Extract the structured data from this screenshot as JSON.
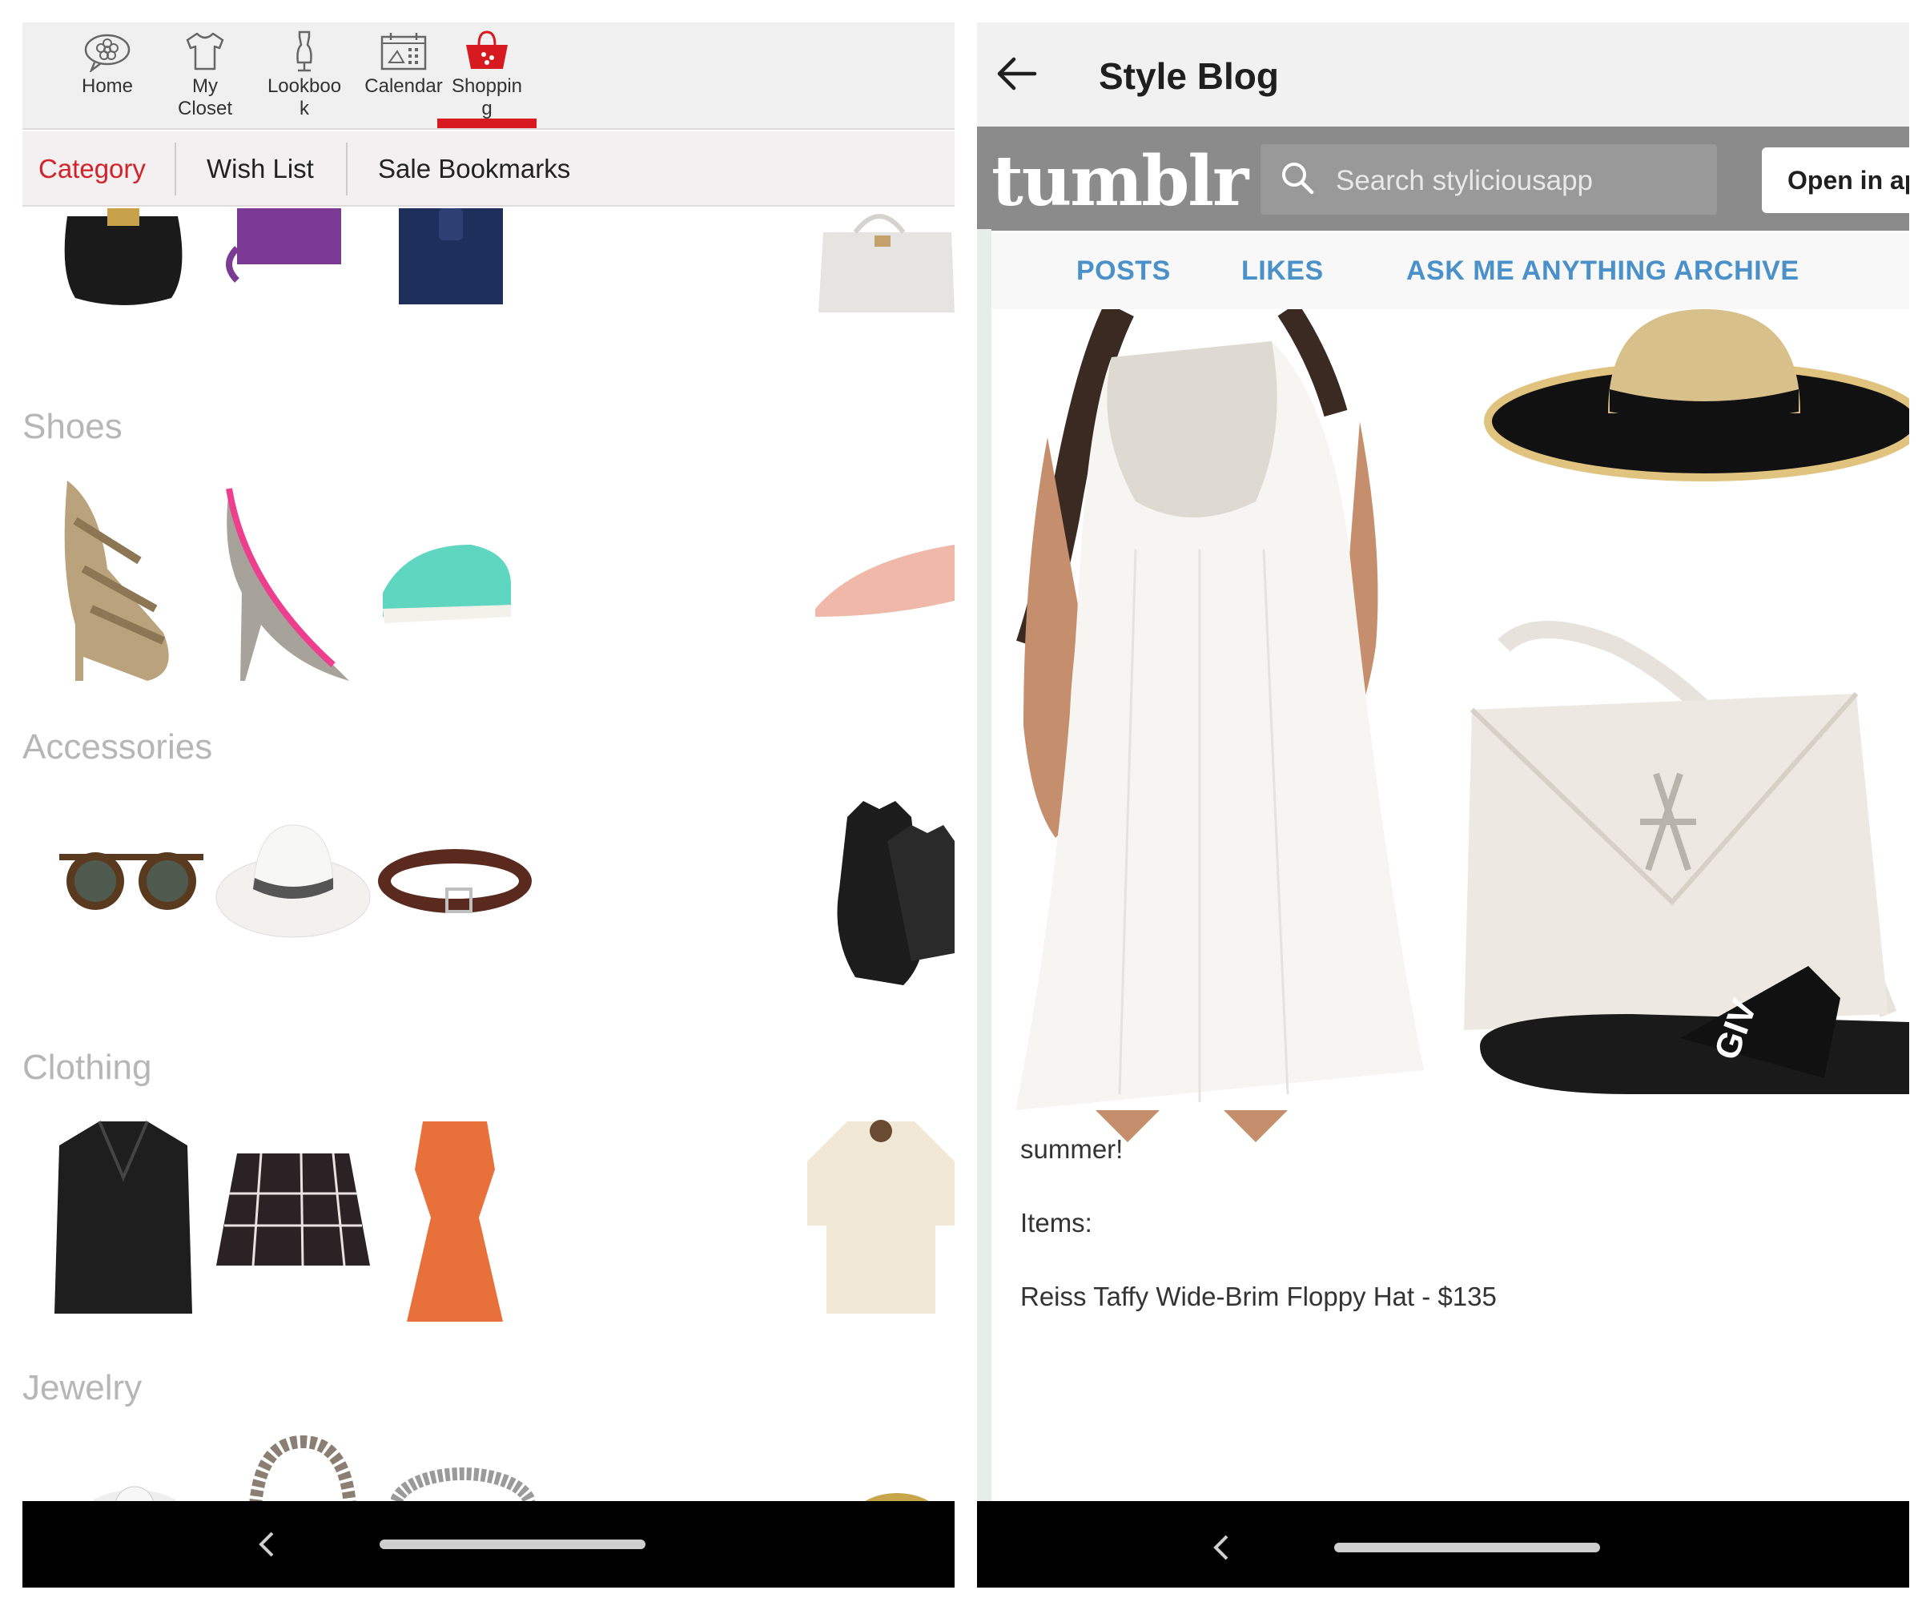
{
  "app_nav": {
    "items": [
      {
        "label": "Home",
        "icon": "home-flower-icon"
      },
      {
        "label": "My\nCloset",
        "icon": "shirt-icon"
      },
      {
        "label": "Lookboo\nk",
        "icon": "dress-form-icon"
      },
      {
        "label": "Calendar",
        "icon": "calendar-icon"
      },
      {
        "label": "Shoppin\ng",
        "icon": "shopping-basket-icon",
        "active": true
      }
    ],
    "accent_color": "#d71920"
  },
  "subtabs": [
    {
      "label": "Category",
      "active": true
    },
    {
      "label": "Wish List"
    },
    {
      "label": "Sale Bookmarks"
    }
  ],
  "categories": [
    {
      "name": "Shoes",
      "items": [
        "glitter-strappy-sandal",
        "pink-trim-pump",
        "mint-canvas-sneaker",
        "blush-dorsay-flat"
      ]
    },
    {
      "name": "Accessories",
      "items": [
        "tortoise-sunglasses",
        "white-panama-hat",
        "brown-leather-belt",
        "black-leather-gloves"
      ]
    },
    {
      "name": "Clothing",
      "items": [
        "black-leather-jacket",
        "plaid-mini-skirt",
        "orange-draped-dress",
        "cream-blouse"
      ]
    },
    {
      "name": "Jewelry",
      "items": [
        "crystal-ring",
        "chain-necklace",
        "crystal-cuff",
        "black-stone-ring"
      ]
    }
  ],
  "top_partial_row": [
    "black-handbag",
    "purple-clutch",
    "navy-tote",
    "white-satchel"
  ],
  "blog": {
    "title": "Style Blog",
    "logo": "tumblr",
    "search_placeholder": "Search styliciousapp",
    "open_app": "Open in ap",
    "tabs": [
      "POSTS",
      "LIKES",
      "ASK ME ANYTHING",
      "ARCHIVE"
    ],
    "tab_color": "#4a90c9",
    "post_lines": [
      "summer!",
      "Items:",
      "Reiss Taffy Wide-Brim Floppy Hat - $135"
    ],
    "images": [
      "white-lace-dress-model",
      "wide-brim-straw-hat",
      "white-crossbody-bag",
      "black-logo-slide"
    ],
    "slide_text": "GIV"
  }
}
